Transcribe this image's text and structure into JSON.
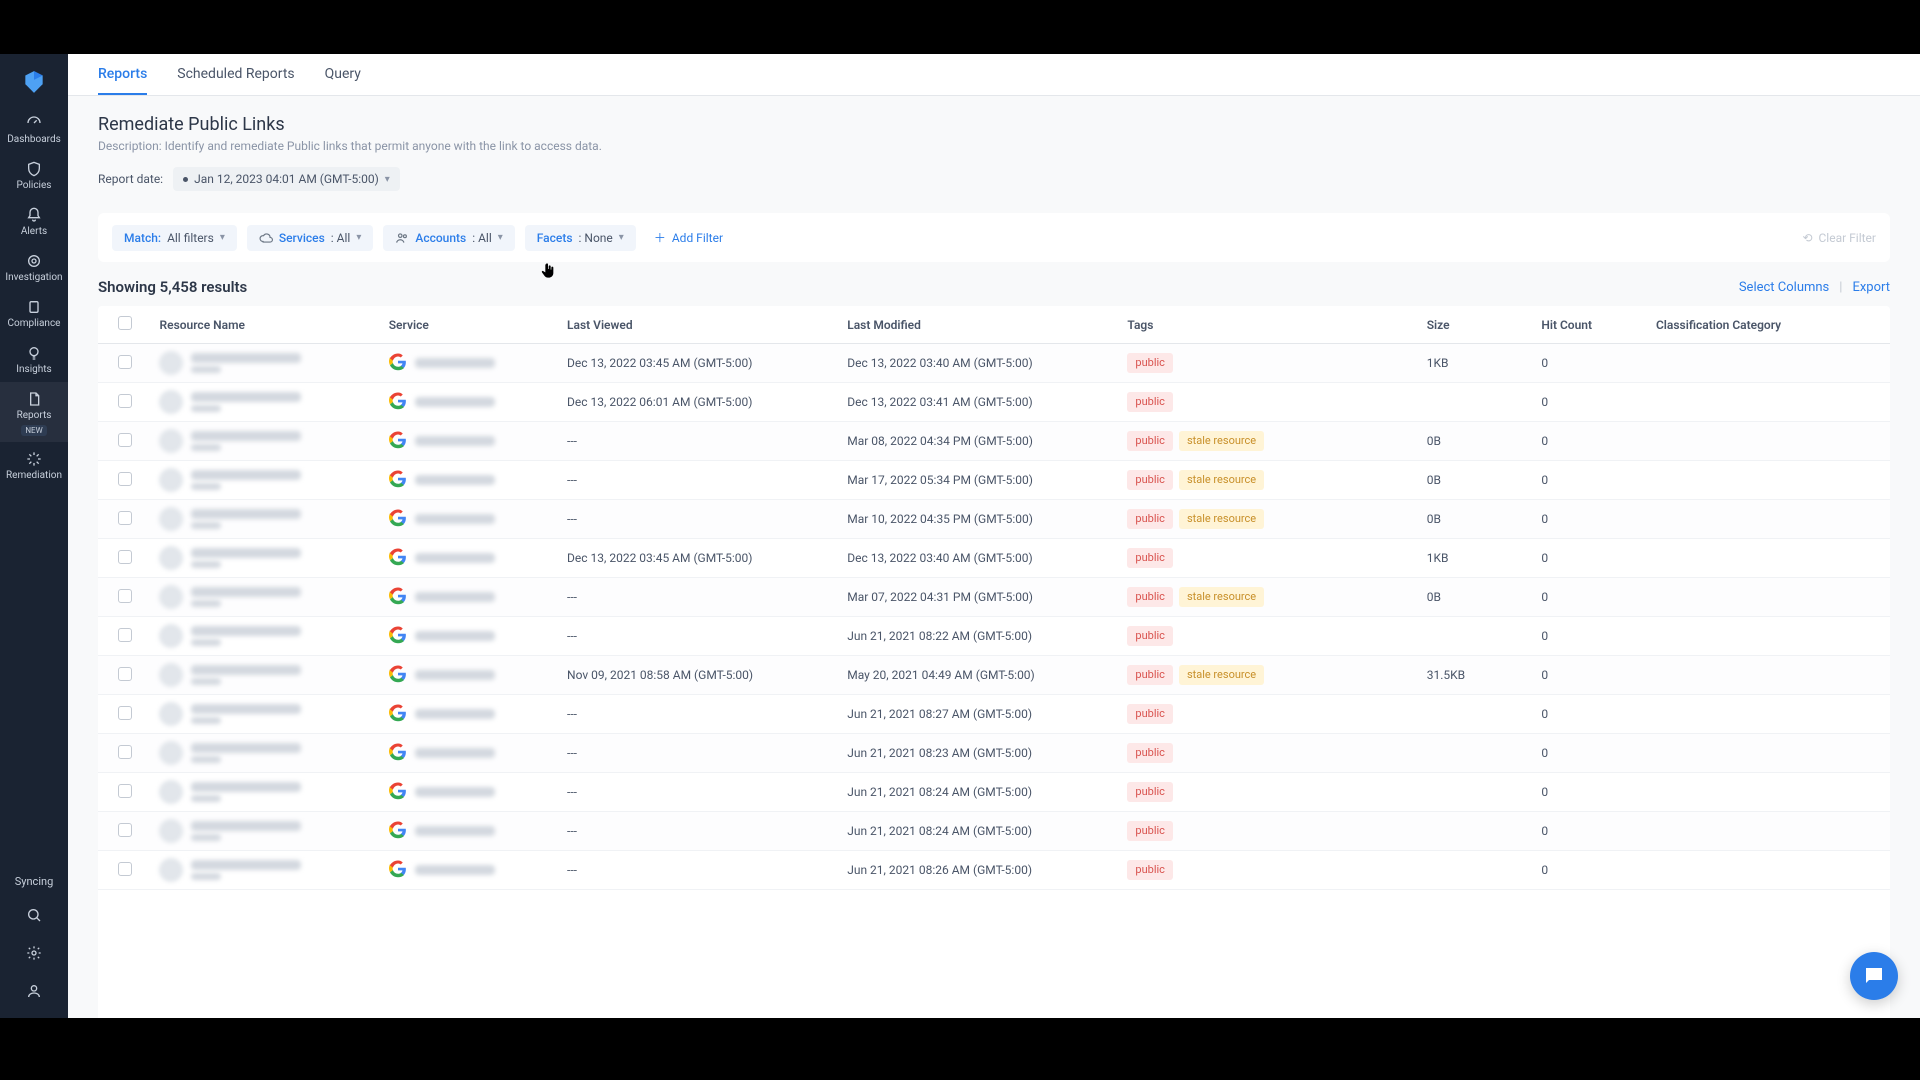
{
  "sidebar": {
    "items": [
      {
        "id": "dashboards",
        "label": "Dashboards"
      },
      {
        "id": "policies",
        "label": "Policies"
      },
      {
        "id": "alerts",
        "label": "Alerts"
      },
      {
        "id": "investigation",
        "label": "Investigation"
      },
      {
        "id": "compliance",
        "label": "Compliance"
      },
      {
        "id": "insights",
        "label": "Insights"
      },
      {
        "id": "reports",
        "label": "Reports",
        "badge": "NEW"
      },
      {
        "id": "remediation",
        "label": "Remediation"
      }
    ],
    "sync_label": "Syncing"
  },
  "tabs": [
    {
      "id": "reports",
      "label": "Reports"
    },
    {
      "id": "scheduled",
      "label": "Scheduled Reports"
    },
    {
      "id": "query",
      "label": "Query"
    }
  ],
  "page": {
    "title": "Remediate Public Links",
    "description": "Description: Identify and remediate Public links that permit anyone with the link to access data."
  },
  "report_date": {
    "label": "Report date:",
    "value": "Jan 12, 2023 04:01 AM (GMT-5:00)"
  },
  "filters": {
    "match": {
      "key": "Match:",
      "val": "All filters"
    },
    "services": {
      "key": "Services",
      "val": ": All"
    },
    "accounts": {
      "key": "Accounts",
      "val": ": All"
    },
    "facets": {
      "key": "Facets",
      "val": ": None"
    },
    "add_label": "Add Filter",
    "clear_label": "Clear Filter"
  },
  "results": {
    "count_text": "Showing 5,458 results",
    "select_columns": "Select Columns",
    "export": "Export"
  },
  "columns": {
    "resource": "Resource Name",
    "service": "Service",
    "last_viewed": "Last Viewed",
    "last_modified": "Last Modified",
    "tags": "Tags",
    "size": "Size",
    "hit_count": "Hit Count",
    "classification": "Classification Category"
  },
  "tag_labels": {
    "public": "public",
    "stale": "stale resource"
  },
  "rows": [
    {
      "last_viewed": "Dec 13, 2022 03:45 AM (GMT-5:00)",
      "last_modified": "Dec 13, 2022 03:40 AM (GMT-5:00)",
      "tags": [
        "public"
      ],
      "size": "1KB",
      "hit": "0"
    },
    {
      "last_viewed": "Dec 13, 2022 06:01 AM (GMT-5:00)",
      "last_modified": "Dec 13, 2022 03:41 AM (GMT-5:00)",
      "tags": [
        "public"
      ],
      "size": "",
      "hit": "0"
    },
    {
      "last_viewed": "---",
      "last_modified": "Mar 08, 2022 04:34 PM (GMT-5:00)",
      "tags": [
        "public",
        "stale"
      ],
      "size": "0B",
      "hit": "0"
    },
    {
      "last_viewed": "---",
      "last_modified": "Mar 17, 2022 05:34 PM (GMT-5:00)",
      "tags": [
        "public",
        "stale"
      ],
      "size": "0B",
      "hit": "0"
    },
    {
      "last_viewed": "---",
      "last_modified": "Mar 10, 2022 04:35 PM (GMT-5:00)",
      "tags": [
        "public",
        "stale"
      ],
      "size": "0B",
      "hit": "0"
    },
    {
      "last_viewed": "Dec 13, 2022 03:45 AM (GMT-5:00)",
      "last_modified": "Dec 13, 2022 03:40 AM (GMT-5:00)",
      "tags": [
        "public"
      ],
      "size": "1KB",
      "hit": "0"
    },
    {
      "last_viewed": "---",
      "last_modified": "Mar 07, 2022 04:31 PM (GMT-5:00)",
      "tags": [
        "public",
        "stale"
      ],
      "size": "0B",
      "hit": "0"
    },
    {
      "last_viewed": "---",
      "last_modified": "Jun 21, 2021 08:22 AM (GMT-5:00)",
      "tags": [
        "public"
      ],
      "size": "",
      "hit": "0"
    },
    {
      "last_viewed": "Nov 09, 2021 08:58 AM (GMT-5:00)",
      "last_modified": "May 20, 2021 04:49 AM (GMT-5:00)",
      "tags": [
        "public",
        "stale"
      ],
      "size": "31.5KB",
      "hit": "0"
    },
    {
      "last_viewed": "---",
      "last_modified": "Jun 21, 2021 08:27 AM (GMT-5:00)",
      "tags": [
        "public"
      ],
      "size": "",
      "hit": "0"
    },
    {
      "last_viewed": "---",
      "last_modified": "Jun 21, 2021 08:23 AM (GMT-5:00)",
      "tags": [
        "public"
      ],
      "size": "",
      "hit": "0"
    },
    {
      "last_viewed": "---",
      "last_modified": "Jun 21, 2021 08:24 AM (GMT-5:00)",
      "tags": [
        "public"
      ],
      "size": "",
      "hit": "0"
    },
    {
      "last_viewed": "---",
      "last_modified": "Jun 21, 2021 08:24 AM (GMT-5:00)",
      "tags": [
        "public"
      ],
      "size": "",
      "hit": "0"
    },
    {
      "last_viewed": "---",
      "last_modified": "Jun 21, 2021 08:26 AM (GMT-5:00)",
      "tags": [
        "public"
      ],
      "size": "",
      "hit": "0"
    }
  ]
}
